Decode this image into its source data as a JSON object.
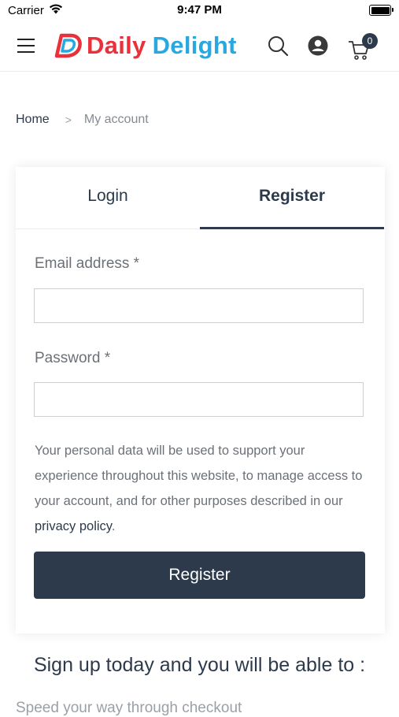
{
  "status_bar": {
    "carrier": "Carrier",
    "time": "9:47 PM"
  },
  "header": {
    "logo_word1": "Daily",
    "logo_word2": "Delight",
    "cart_count": "0",
    "brand_red": "#e8313b",
    "brand_blue": "#28a8e0"
  },
  "breadcrumb": {
    "home": "Home",
    "separator": ">",
    "current": "My account"
  },
  "tabs": {
    "login": "Login",
    "register": "Register"
  },
  "form": {
    "email_label": "Email address *",
    "email_value": "",
    "password_label": "Password *",
    "password_value": "",
    "privacy_text": "Your personal data will be used to support your experience throughout this website, to manage access to your account, and for other purposes described in our ",
    "privacy_link": "privacy policy",
    "privacy_end": ".",
    "submit_label": "Register"
  },
  "signup": {
    "heading": "Sign up today and you will be able to :",
    "cut_text": "Speed your way through checkout"
  },
  "colors": {
    "primary": "#2c3a4b",
    "muted": "#6c7177"
  }
}
